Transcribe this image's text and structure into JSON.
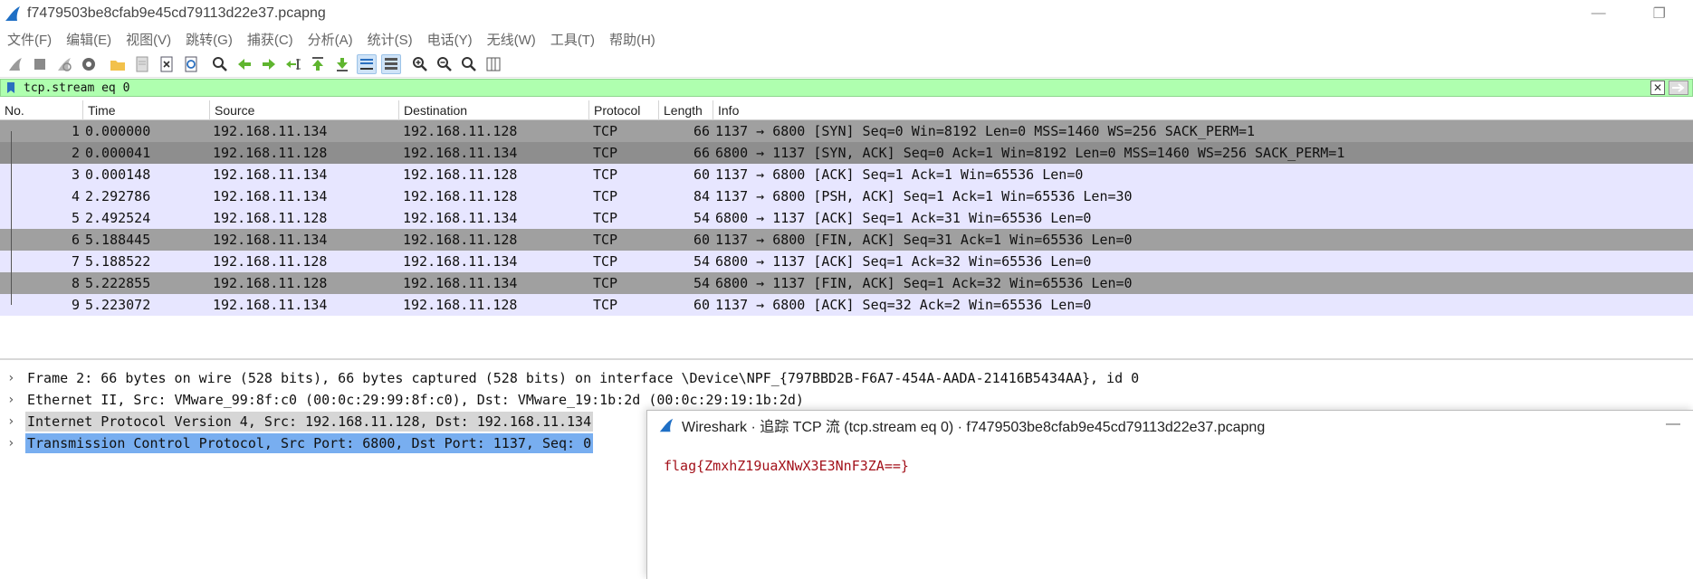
{
  "window": {
    "title": "f7479503be8cfab9e45cd79113d22e37.pcapng",
    "minimize": "—",
    "restore": "❐"
  },
  "menu": [
    "文件(F)",
    "编辑(E)",
    "视图(V)",
    "跳转(G)",
    "捕获(C)",
    "分析(A)",
    "统计(S)",
    "电话(Y)",
    "无线(W)",
    "工具(T)",
    "帮助(H)"
  ],
  "filter": {
    "value": "tcp.stream eq 0",
    "clear_glyph": "✕"
  },
  "columns": [
    "No.",
    "Time",
    "Source",
    "Destination",
    "Protocol",
    "Length",
    "Info"
  ],
  "packets": [
    {
      "no": "1",
      "time": "0.000000",
      "src": "192.168.11.134",
      "dst": "192.168.11.128",
      "proto": "TCP",
      "len": "66",
      "info": "1137 → 6800 [SYN] Seq=0 Win=8192 Len=0 MSS=1460 WS=256 SACK_PERM=1"
    },
    {
      "no": "2",
      "time": "0.000041",
      "src": "192.168.11.128",
      "dst": "192.168.11.134",
      "proto": "TCP",
      "len": "66",
      "info": "6800 → 1137 [SYN, ACK] Seq=0 Ack=1 Win=8192 Len=0 MSS=1460 WS=256 SACK_PERM=1"
    },
    {
      "no": "3",
      "time": "0.000148",
      "src": "192.168.11.134",
      "dst": "192.168.11.128",
      "proto": "TCP",
      "len": "60",
      "info": "1137 → 6800 [ACK] Seq=1 Ack=1 Win=65536 Len=0"
    },
    {
      "no": "4",
      "time": "2.292786",
      "src": "192.168.11.134",
      "dst": "192.168.11.128",
      "proto": "TCP",
      "len": "84",
      "info": "1137 → 6800 [PSH, ACK] Seq=1 Ack=1 Win=65536 Len=30"
    },
    {
      "no": "5",
      "time": "2.492524",
      "src": "192.168.11.128",
      "dst": "192.168.11.134",
      "proto": "TCP",
      "len": "54",
      "info": "6800 → 1137 [ACK] Seq=1 Ack=31 Win=65536 Len=0"
    },
    {
      "no": "6",
      "time": "5.188445",
      "src": "192.168.11.134",
      "dst": "192.168.11.128",
      "proto": "TCP",
      "len": "60",
      "info": "1137 → 6800 [FIN, ACK] Seq=31 Ack=1 Win=65536 Len=0"
    },
    {
      "no": "7",
      "time": "5.188522",
      "src": "192.168.11.128",
      "dst": "192.168.11.134",
      "proto": "TCP",
      "len": "54",
      "info": "6800 → 1137 [ACK] Seq=1 Ack=32 Win=65536 Len=0"
    },
    {
      "no": "8",
      "time": "5.222855",
      "src": "192.168.11.128",
      "dst": "192.168.11.134",
      "proto": "TCP",
      "len": "54",
      "info": "6800 → 1137 [FIN, ACK] Seq=1 Ack=32 Win=65536 Len=0"
    },
    {
      "no": "9",
      "time": "5.223072",
      "src": "192.168.11.134",
      "dst": "192.168.11.128",
      "proto": "TCP",
      "len": "60",
      "info": "1137 → 6800 [ACK] Seq=32 Ack=2 Win=65536 Len=0"
    }
  ],
  "row_styles": [
    "dark",
    "sel",
    "light",
    "light",
    "light",
    "dark",
    "light",
    "dark",
    "light"
  ],
  "details": [
    {
      "text": "Frame 2: 66 bytes on wire (528 bits), 66 bytes captured (528 bits) on interface \\Device\\NPF_{797BBD2B-F6A7-454A-AADA-21416B5434AA}, id 0",
      "style": ""
    },
    {
      "text": "Ethernet II, Src: VMware_99:8f:c0 (00:0c:29:99:8f:c0), Dst: VMware_19:1b:2d (00:0c:29:19:1b:2d)",
      "style": ""
    },
    {
      "text": "Internet Protocol Version 4, Src: 192.168.11.128, Dst: 192.168.11.134",
      "style": "hl"
    },
    {
      "text": "Transmission Control Protocol, Src Port: 6800, Dst Port: 1137, Seq: 0",
      "style": "sel"
    }
  ],
  "dialog": {
    "title": "Wireshark · 追踪 TCP 流 (tcp.stream eq 0) · f7479503be8cfab9e45cd79113d22e37.pcapng",
    "minimize": "—",
    "content": "flag{ZmxhZ19uaXNwX3E3NnF3ZA==}"
  },
  "colors": {
    "filter_bg": "#afffaf",
    "row_light": "#e7e6ff",
    "row_dark": "#a0a0a0",
    "detail_selected": "#78aef0",
    "stream_text": "#a3121b"
  }
}
